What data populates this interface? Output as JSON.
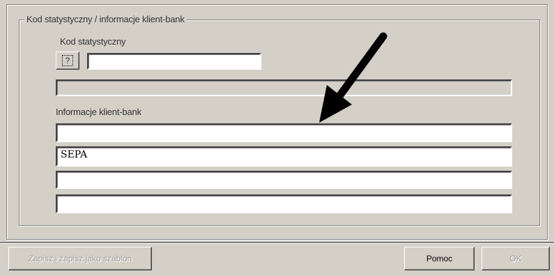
{
  "group": {
    "title": "Kod statystyczny / informacje klient-bank"
  },
  "stat_code": {
    "label": "Kod statystyczny",
    "lookup_label": "?",
    "value": "",
    "description_value": ""
  },
  "client_bank": {
    "label": "Informacje klient-bank",
    "lines": [
      "",
      "SEPA",
      "",
      ""
    ]
  },
  "footer": {
    "save_template_label": "Zapisz i zapisz jako szablon",
    "help_label": "Pomoc",
    "ok_label": "OK"
  },
  "annotation": {
    "arrow_icon": "arrow-pointer-icon",
    "color": "#000000"
  }
}
